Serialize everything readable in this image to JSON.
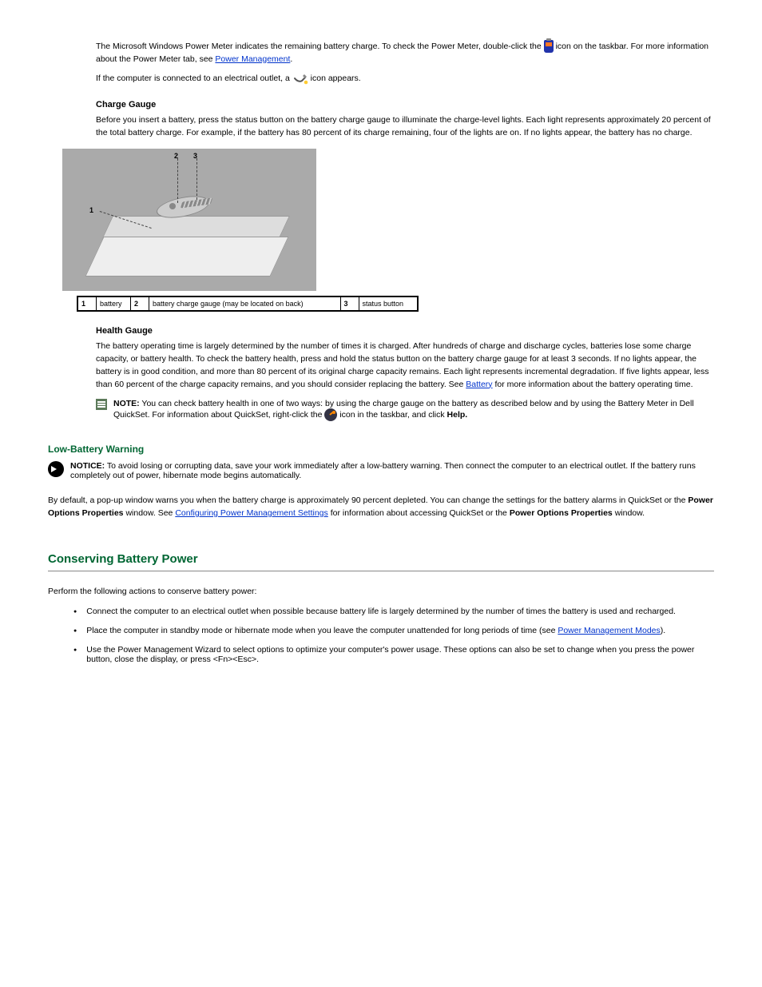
{
  "meter_section": {
    "p1_before": "The Microsoft Windows Power Meter indicates the remaining battery charge. To check the Power Meter, double-click the ",
    "p1_after": " icon on the taskbar.",
    "p2": "For more information about the Power Meter tab, see ",
    "p2_link": "Power Management",
    "p3_before": "If the computer is connected to an electrical outlet, a ",
    "p3_after": " icon appears."
  },
  "charge_gauge": {
    "heading": "Charge Gauge",
    "para_a": "Before you insert a battery, press the status button on the battery charge gauge to illuminate the charge-level lights. Each light represents approximately 20 percent of the total battery charge. For example, if the battery has 80 percent of its charge remaining, four of the lights are on. If no lights appear, the battery has no charge.",
    "fig": {
      "callouts": [
        "1",
        "2",
        "3"
      ],
      "parts": [
        {
          "num": "1",
          "label": "battery"
        },
        {
          "num": "2",
          "label": "battery charge gauge (may be located on back)"
        },
        {
          "num": "3",
          "label": "status button"
        }
      ]
    }
  },
  "health_gauge": {
    "heading": "Health Gauge",
    "p1": "The battery operating time is largely determined by the number of times it is charged. After hundreds of charge and discharge cycles, batteries lose some charge capacity, or battery health. To check the battery health, press and hold the status button on the battery charge gauge for at least 3 seconds. If no lights appear, the battery is in good condition, and more than 80 percent of its original charge capacity remains. Each light represents incremental degradation. If five lights appear, less than 60 percent of the charge capacity remains, and you should consider replacing the battery. See ",
    "p1_link": "Battery",
    "p1_after": " for more information about the battery operating time.",
    "note_label": "NOTE:",
    "note_text_before": "You can check battery health in one of two ways: by using the charge gauge on the battery as described below and by using the Battery Meter in Dell QuickSet. For information about QuickSet, right-click the ",
    "note_text_after": " icon in the taskbar, and click ",
    "note_help": "Help."
  },
  "low_warn": {
    "heading": "Low-Battery Warning",
    "notice_label": "NOTICE:",
    "notice_text": "To avoid losing or corrupting data, save your work immediately after a low-battery warning. Then connect the computer to an electrical outlet. If the battery runs completely out of power, hibernate mode begins automatically.",
    "p1_before": "By default, a pop-up window warns you when the battery charge is approximately 90 percent depleted. You can change the settings for the battery alarms in QuickSet or the ",
    "p1_strong": "Power Options Properties",
    "p1_mid": " window. See ",
    "p1_link": "Configuring Power Management Settings",
    "p1_after": " for information about accessing QuickSet or the ",
    "p1_strong2": "Power Options Properties",
    "p1_tail": " window."
  },
  "conserving": {
    "title": "Conserving Battery Power",
    "intro": "Perform the following actions to conserve battery power:",
    "bullets": [
      "Connect the computer to an electrical outlet when possible because battery life is largely determined by the number of times the battery is used and recharged.",
      "Place the computer in standby mode or hibernate mode when you leave the computer unattended for long periods of time (see ",
      "Use the Power Management Wizard to select options to optimize your computer's power usage. These options can also be set to change when you press the power button, close the display, or press <Fn><Esc>."
    ],
    "bullet2_link": "Power Management Modes",
    "bullet2_after": ")."
  }
}
